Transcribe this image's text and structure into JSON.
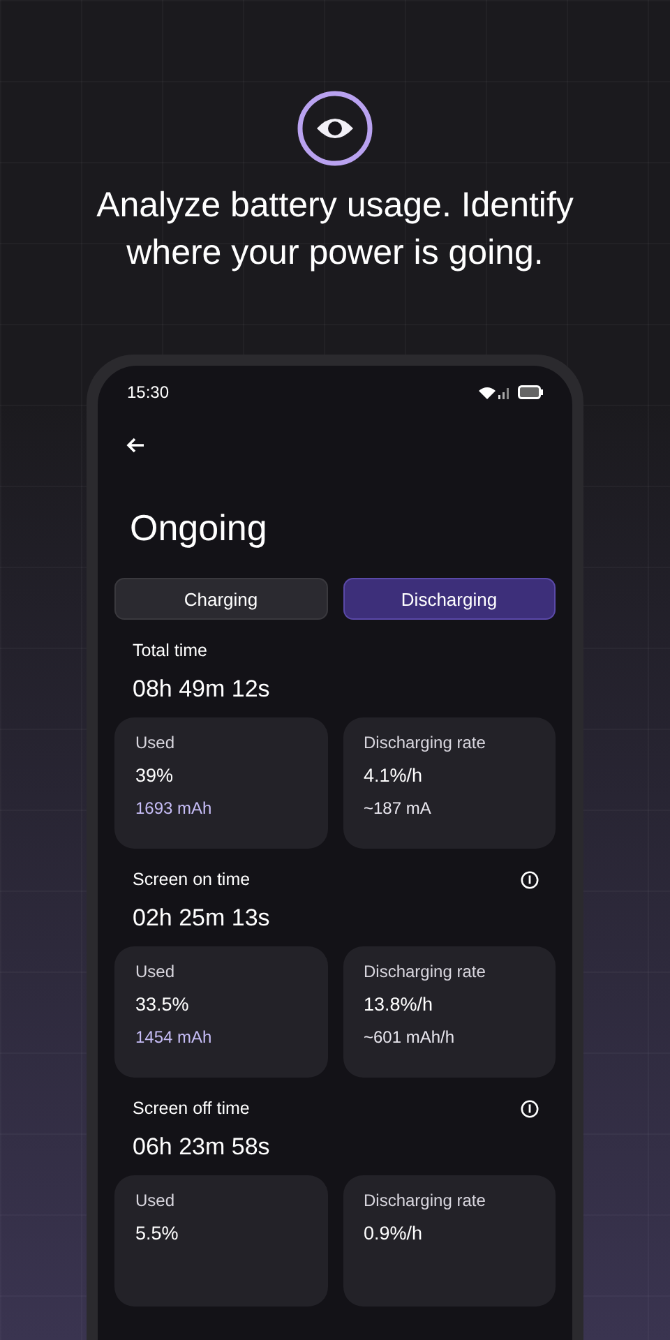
{
  "headline": "Analyze battery usage. Identify where your power is going.",
  "status_bar": {
    "time": "15:30"
  },
  "title": "Ongoing",
  "tabs": [
    {
      "label": "Charging",
      "selected": false
    },
    {
      "label": "Discharging",
      "selected": true
    }
  ],
  "sections": [
    {
      "title": "Total time",
      "info": false,
      "duration": "08h 49m 12s",
      "cards": [
        {
          "label": "Used",
          "value": "39%",
          "detail": "1693 mAh",
          "accent": true
        },
        {
          "label": "Discharging rate",
          "value": "4.1%/h",
          "detail": "~187 mA",
          "accent": false
        }
      ]
    },
    {
      "title": "Screen on time",
      "info": true,
      "duration": "02h 25m 13s",
      "cards": [
        {
          "label": "Used",
          "value": "33.5%",
          "detail": "1454 mAh",
          "accent": true
        },
        {
          "label": "Discharging rate",
          "value": "13.8%/h",
          "detail": "~601 mAh/h",
          "accent": false
        }
      ]
    },
    {
      "title": "Screen off time",
      "info": true,
      "duration": "06h 23m 58s",
      "cards": [
        {
          "label": "Used",
          "value": "5.5%"
        },
        {
          "label": "Discharging rate",
          "value": "0.9%/h"
        }
      ]
    }
  ]
}
